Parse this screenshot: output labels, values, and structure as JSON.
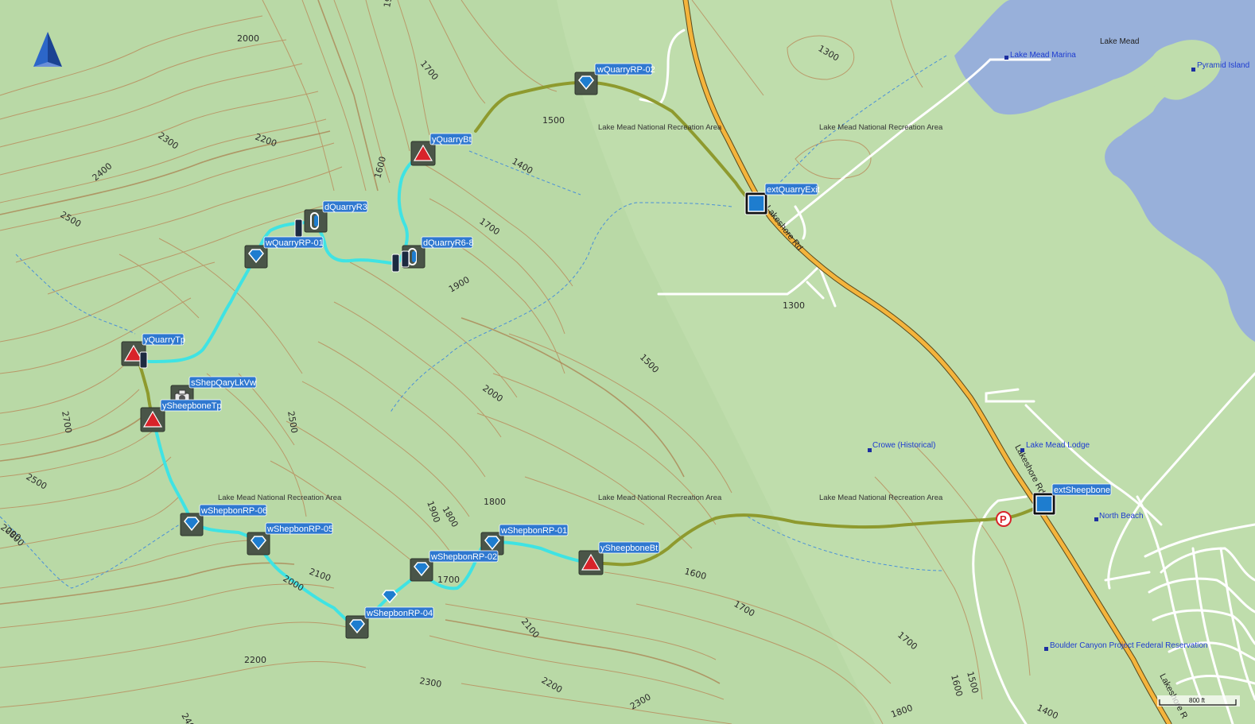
{
  "map": {
    "lake_name": "Lake Mead",
    "area_labels": [
      "Lake Mead National Recreation Area",
      "Lake Mead National Recreation Area",
      "Lake Mead National Recreation Area",
      "Lake Mead National Recreation Area",
      "Lake Mead National Recreation Area"
    ],
    "road_names": [
      "Lakeshore Rd",
      "Lakeshore Rd",
      "Lakeshore R"
    ],
    "pois": [
      "Lake Mead Marina",
      "Pyramid Island",
      "Crowe (Historical)",
      "Lake Mead Lodge",
      "North Beach",
      "Boulder Canyon Project Federal Reservation"
    ],
    "parking_symbol": "P",
    "scale_label": "800 ft",
    "contour_labels": [
      "2000",
      "1900",
      "1700",
      "2300",
      "2200",
      "2400",
      "2500",
      "1600",
      "1500",
      "1400",
      "1300",
      "1700",
      "1900",
      "2700",
      "2500",
      "2500",
      "2000",
      "1300",
      "1500",
      "2000",
      "1800",
      "1900",
      "1800",
      "2100",
      "2000",
      "1700",
      "1600",
      "1700",
      "2100",
      "2200",
      "2200",
      "2300",
      "2300",
      "1700",
      "1600",
      "1500",
      "1400",
      "1800",
      "2800",
      "2400"
    ],
    "waypoints": [
      {
        "label": "wQuarryRP-02",
        "type": "diamond"
      },
      {
        "label": "yQuarryBt",
        "type": "triangle"
      },
      {
        "label": "extQuarryExit",
        "type": "square"
      },
      {
        "label": "dQuarryR3",
        "type": "link"
      },
      {
        "label": "wQuarryRP-01",
        "type": "diamond"
      },
      {
        "label": "dQuarryR6-8",
        "type": "link"
      },
      {
        "label": "yQuarryTp",
        "type": "triangle"
      },
      {
        "label": "sShepQaryLkVw",
        "type": "camera"
      },
      {
        "label": "ySheepboneTp",
        "type": "triangle"
      },
      {
        "label": "wShepbonRP-06",
        "type": "diamond"
      },
      {
        "label": "wShepbonRP-05",
        "type": "diamond"
      },
      {
        "label": "wShepbonRP-01",
        "type": "diamond"
      },
      {
        "label": "wShepbonRP-02",
        "type": "diamond"
      },
      {
        "label": "ySheepboneBt",
        "type": "triangle"
      },
      {
        "label": "wShepbonRP-04",
        "type": "diamond"
      },
      {
        "label": "extSheepbone",
        "type": "square"
      }
    ]
  },
  "colors": {
    "terrain": "#b9d9a6",
    "lake": "#98b0da",
    "contour": "#b98a5a",
    "track_cyan": "#3fe3e3",
    "track_olive": "#8e9a2e",
    "highway": "#f4b43c",
    "label_bg": "#2f78d0",
    "marker_red": "#d8232a",
    "stream": "#4a90d8"
  },
  "icons": {
    "north_arrow": "north-arrow-icon",
    "diamond": "diamond-waypoint-icon",
    "triangle": "summit-triangle-icon",
    "square": "exit-square-icon",
    "camera": "camera-icon",
    "link": "chain-link-icon"
  }
}
